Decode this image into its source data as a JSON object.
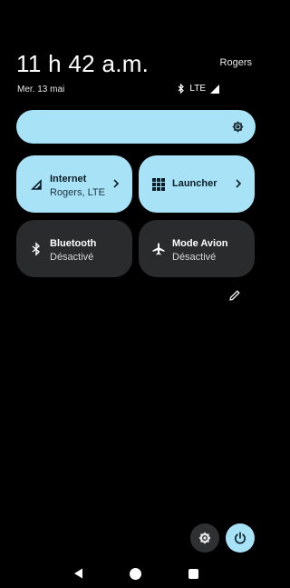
{
  "header": {
    "clock": "11 h 42 a.m.",
    "carrier": "Rogers",
    "date": "Mer. 13 mai",
    "network_type": "LTE"
  },
  "brightness": {
    "icon": "brightness-icon"
  },
  "tiles": [
    {
      "title": "Internet",
      "subtitle": "Rogers, LTE",
      "state": "on",
      "icon": "cellular-signal-icon",
      "has_chevron": true
    },
    {
      "title": "Launcher",
      "subtitle": "",
      "state": "on",
      "icon": "grid-icon",
      "has_chevron": true
    },
    {
      "title": "Bluetooth",
      "subtitle": "Désactivé",
      "state": "off",
      "icon": "bluetooth-icon",
      "has_chevron": false
    },
    {
      "title": "Mode Avion",
      "subtitle": "Désactivé",
      "state": "off",
      "icon": "airplane-icon",
      "has_chevron": false
    }
  ],
  "colors": {
    "background": "#000000",
    "tile_on": "#a8e2f7",
    "tile_off": "#2a2b2c",
    "text_on_dark": "#ffffff"
  }
}
